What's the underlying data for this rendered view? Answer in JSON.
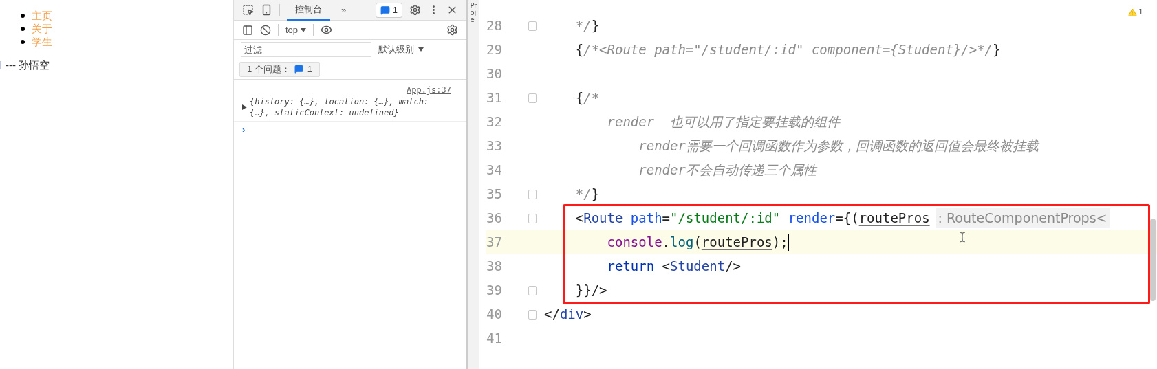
{
  "page": {
    "nav_links": [
      {
        "label": "主页"
      },
      {
        "label": "关于"
      },
      {
        "label": "学生"
      }
    ],
    "content": "--- 孙悟空"
  },
  "devtools": {
    "tabs": [
      {
        "label": "控制台",
        "selected": true
      }
    ],
    "more": "»",
    "issues_badge": "1",
    "context": "top",
    "filter": {
      "placeholder": "过滤"
    },
    "level_select": "默认级别",
    "issues_button": {
      "label": "1 个问题：",
      "count": "1"
    },
    "messages": [
      {
        "source": "App.js:37",
        "text": "{history: {…}, location: {…}, match: {…}, staticContext: undefined}",
        "expanded": false
      }
    ],
    "prompt": "›"
  },
  "editor": {
    "side_tab": "Proje",
    "warnings": "1",
    "lines": [
      {
        "number": "28",
        "boxed": false,
        "current": false,
        "fold": true,
        "tokens": [
          {
            "text": "    */",
            "kind": "comment"
          },
          {
            "text": "}",
            "kind": "plain"
          }
        ]
      },
      {
        "number": "29",
        "boxed": false,
        "current": false,
        "fold": false,
        "tokens": [
          {
            "text": "    {",
            "kind": "plain"
          },
          {
            "text": "/*<Route path=\"/student/:id\" component={Student}/>*/",
            "kind": "comment"
          },
          {
            "text": "}",
            "kind": "plain"
          }
        ]
      },
      {
        "number": "30",
        "boxed": false,
        "current": false,
        "fold": false
      },
      {
        "number": "31",
        "boxed": false,
        "current": false,
        "fold": true,
        "tokens": [
          {
            "text": "    {",
            "kind": "plain"
          },
          {
            "text": "/*",
            "kind": "comment"
          }
        ]
      },
      {
        "number": "32",
        "boxed": false,
        "current": false,
        "fold": false,
        "tokens": [
          {
            "text": "        render  也可以用了指定要挂载的组件",
            "kind": "comment"
          }
        ]
      },
      {
        "number": "33",
        "boxed": false,
        "current": false,
        "fold": false,
        "tokens": [
          {
            "text": "            render需要一个回调函数作为参数，回调函数的返回值会最终被挂载",
            "kind": "comment"
          }
        ]
      },
      {
        "number": "34",
        "boxed": false,
        "current": false,
        "fold": false,
        "tokens": [
          {
            "text": "            render不会自动传递三个属性",
            "kind": "comment"
          }
        ]
      },
      {
        "number": "35",
        "boxed": false,
        "current": false,
        "fold": true,
        "tokens": [
          {
            "text": "    */",
            "kind": "comment"
          },
          {
            "text": "}",
            "kind": "plain"
          }
        ]
      },
      {
        "number": "36",
        "boxed": true,
        "current": false,
        "fold": true,
        "tokens": [
          {
            "text": "    <",
            "kind": "plain"
          },
          {
            "text": "Route",
            "kind": "tag"
          },
          {
            "text": " path",
            "kind": "attr"
          },
          {
            "text": "=",
            "kind": "plain"
          },
          {
            "text": "\"/student/:id\"",
            "kind": "string"
          },
          {
            "text": " render",
            "kind": "attr"
          },
          {
            "text": "={(",
            "kind": "plain"
          },
          {
            "text": "routePros",
            "kind": "param"
          },
          {
            "text": ": RouteComponentProps<",
            "kind": "hint"
          }
        ]
      },
      {
        "number": "37",
        "boxed": true,
        "current": true,
        "fold": false,
        "tokens": [
          {
            "text": "        console",
            "kind": "object"
          },
          {
            "text": ".",
            "kind": "plain"
          },
          {
            "text": "log",
            "kind": "method"
          },
          {
            "text": "(",
            "kind": "plain"
          },
          {
            "text": "routePros",
            "kind": "param"
          },
          {
            "text": ");",
            "kind": "plain"
          }
        ]
      },
      {
        "number": "38",
        "boxed": true,
        "current": false,
        "fold": false,
        "tokens": [
          {
            "text": "        return",
            "kind": "keyword"
          },
          {
            "text": " <",
            "kind": "plain"
          },
          {
            "text": "Student",
            "kind": "tag"
          },
          {
            "text": "/>",
            "kind": "plain"
          }
        ]
      },
      {
        "number": "39",
        "boxed": true,
        "current": false,
        "fold": true,
        "tokens": [
          {
            "text": "    }}/>",
            "kind": "plain"
          }
        ]
      },
      {
        "number": "40",
        "boxed": false,
        "current": false,
        "fold": true,
        "tokens": [
          {
            "text": "</",
            "kind": "plain"
          },
          {
            "text": "div",
            "kind": "tag"
          },
          {
            "text": ">",
            "kind": "plain"
          }
        ]
      },
      {
        "number": "41",
        "boxed": false,
        "current": false,
        "fold": false
      }
    ]
  }
}
